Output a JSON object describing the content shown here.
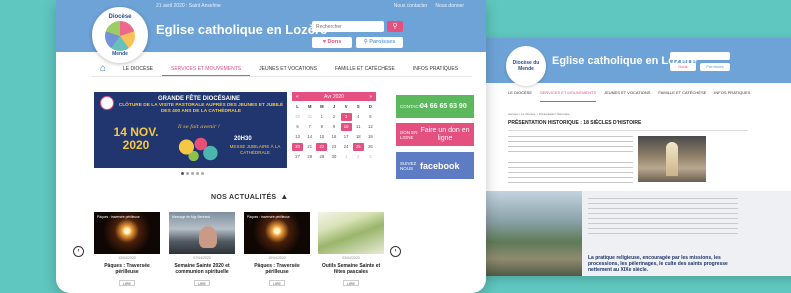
{
  "back_window": {
    "logo_text": "Diocèse du Mende",
    "site_title": "Eglise catholique en Lozère",
    "donate_label": "Dons",
    "parishes_label": "Paroisses",
    "nav": [
      "LE DIOCÈSE",
      "SERVICES ET MOUVEMENTS",
      "JEUNES ET VOCATIONS",
      "FAMILLE ET CATÉCHÈSE",
      "INFOS PRATIQUES"
    ],
    "breadcrumb": "Accueil > Le diocèse > Présentation historique",
    "heading": "PRÉSENTATION HISTORIQUE : 18 SIÈCLES D'HISTOIRE",
    "quote": "La pratique religieuse, encouragée par les missions, les processions, les pèlerinages, le culte des saints progresse nettement au XIXe siècle."
  },
  "topbar": {
    "date": "21 avril 2020 : Saint Anselme",
    "links": [
      "Nous contacter",
      "Nous donner"
    ]
  },
  "logo": {
    "line1": "Diocèse",
    "line2": "Mende"
  },
  "site_title": "Eglise catholique en Lozère",
  "search": {
    "placeholder": "Rechercher"
  },
  "header_buttons": {
    "donate": "♥ Dons",
    "parishes": "⚲ Paroisses"
  },
  "nav": {
    "items": [
      {
        "label": "LE DIOCÈSE",
        "active": false
      },
      {
        "label": "SERVICES ET MOUVEMENTS",
        "active": true
      },
      {
        "label": "JEUNES ET VOCATIONS",
        "active": false
      },
      {
        "label": "FAMILLE ET CATÉCHÈSE",
        "active": false
      },
      {
        "label": "INFOS PRATIQUES",
        "active": false
      }
    ]
  },
  "banner": {
    "title": "GRANDE FÊTE DIOCÉSAINE",
    "subtitle": "CLÔTURE DE LA VISITE PASTORALE AUPRÈS DES JEUNES ET JUBILÉ DES 400 ANS DE LA CATHÉDRALE",
    "date": "14 NOV. 2020",
    "script": "Il se fait avenir !",
    "time": "20H30",
    "mass": "MESSE JUBILAIRE À LA CATHÉDRALE"
  },
  "calendar": {
    "month": "Avr 2020",
    "weekdays": [
      "L",
      "M",
      "M",
      "J",
      "V",
      "S",
      "D"
    ],
    "days": [
      {
        "d": "30",
        "m": true
      },
      {
        "d": "31",
        "m": true
      },
      {
        "d": "1"
      },
      {
        "d": "2"
      },
      {
        "d": "3",
        "e": true
      },
      {
        "d": "4"
      },
      {
        "d": "5"
      },
      {
        "d": "6"
      },
      {
        "d": "7"
      },
      {
        "d": "8"
      },
      {
        "d": "9"
      },
      {
        "d": "10",
        "e": true
      },
      {
        "d": "11"
      },
      {
        "d": "12"
      },
      {
        "d": "13"
      },
      {
        "d": "14"
      },
      {
        "d": "15"
      },
      {
        "d": "16"
      },
      {
        "d": "17"
      },
      {
        "d": "18"
      },
      {
        "d": "19"
      },
      {
        "d": "20",
        "e": true
      },
      {
        "d": "21"
      },
      {
        "d": "22",
        "e": true
      },
      {
        "d": "23"
      },
      {
        "d": "24"
      },
      {
        "d": "25",
        "e": true
      },
      {
        "d": "26"
      },
      {
        "d": "27"
      },
      {
        "d": "28"
      },
      {
        "d": "29"
      },
      {
        "d": "30"
      },
      {
        "d": "1",
        "m": true
      },
      {
        "d": "2",
        "m": true
      },
      {
        "d": "3",
        "m": true
      }
    ]
  },
  "side": {
    "contact_label": "CONTACT",
    "phone": "04 66 65 63 90",
    "don_label": "DON EN LIGNE",
    "don_text": "Faire un don en ligne",
    "fb_label": "SUIVEZ NOUS",
    "fb_text": "facebook"
  },
  "news": {
    "title": "NOS ACTUALITÉS",
    "read_label": "LIRE",
    "cards": [
      {
        "date": "10/04/2020",
        "title": "Pâques : Traversée périlleuse",
        "caption": "Pâques : traversée périlleuse"
      },
      {
        "date": "07/04/2020",
        "title": "Semaine Sainte 2020 et communion spirituelle",
        "caption": "Message de Mgr Bertrand"
      },
      {
        "date": "10/04/2020",
        "title": "Pâques : Traversée périlleuse",
        "caption": "Pâques : traversée périlleuse"
      },
      {
        "date": "03/04/2020",
        "title": "Outils Semaine Sainte et fêtes pascales",
        "caption": ""
      }
    ]
  },
  "colors": {
    "header_blue": "#6ea3d7",
    "accent_pink": "#e4507f",
    "contact_green": "#5cb85c",
    "facebook_blue": "#5e7cc4"
  }
}
